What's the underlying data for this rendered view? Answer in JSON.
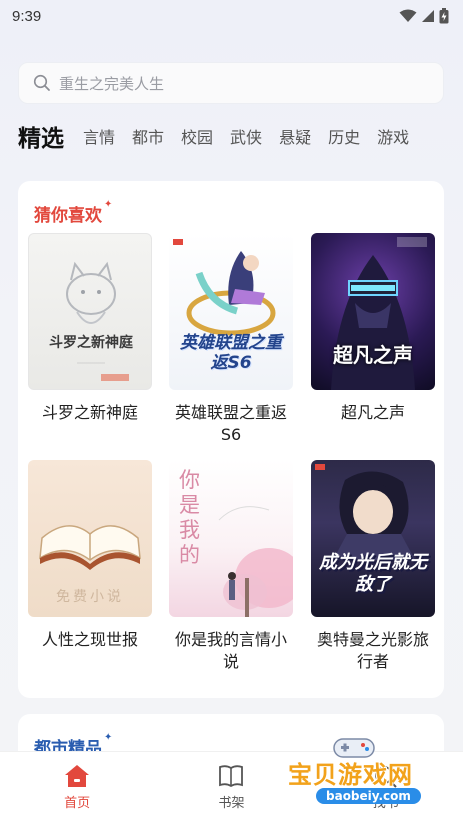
{
  "status_bar": {
    "time": "9:39"
  },
  "search": {
    "placeholder": "重生之完美人生"
  },
  "tabs": [
    {
      "label": "精选",
      "active": true
    },
    {
      "label": "言情"
    },
    {
      "label": "都市"
    },
    {
      "label": "校园"
    },
    {
      "label": "武侠"
    },
    {
      "label": "悬疑"
    },
    {
      "label": "历史"
    },
    {
      "label": "游戏"
    }
  ],
  "sections": {
    "recommend": {
      "title": "猜你喜欢",
      "books": [
        {
          "title": "斗罗之新神庭",
          "cover_text": "斗罗之新神庭"
        },
        {
          "title": "英雄联盟之重返S6",
          "cover_text": "英雄联盟之重返S6"
        },
        {
          "title": "超凡之声",
          "cover_text": "超凡之声"
        },
        {
          "title": "人性之现世报",
          "cover_text": "免费小说"
        },
        {
          "title": "你是我的言情小说",
          "cover_text": "你是我的"
        },
        {
          "title": "奥特曼之光影旅行者",
          "cover_text": "成为光后就无敌了"
        }
      ]
    },
    "city": {
      "title": "都市精品"
    }
  },
  "nav": {
    "home": "首页",
    "shelf": "书架",
    "third": "找书"
  },
  "watermark": {
    "text": "宝贝游戏网",
    "url": "baobeiy.com"
  },
  "colors": {
    "accent": "#e2483d"
  }
}
